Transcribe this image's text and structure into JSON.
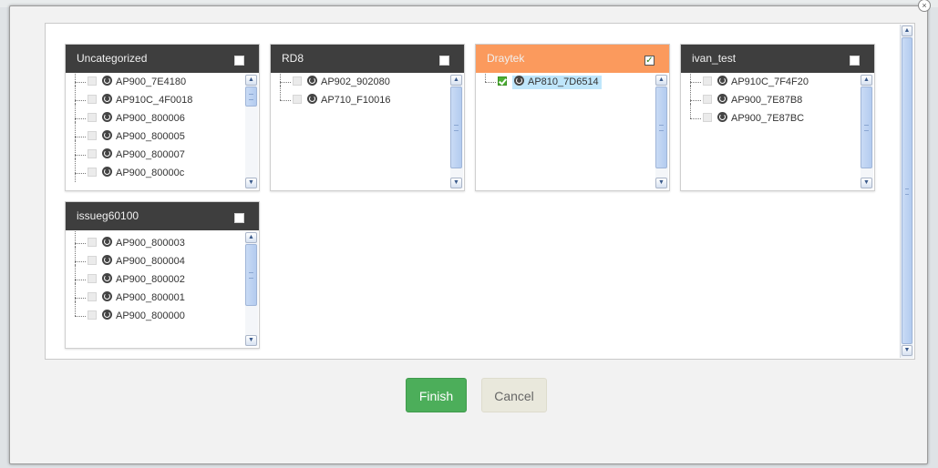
{
  "dialog": {
    "close_glyph": "×"
  },
  "groups": [
    {
      "title": "Uncategorized",
      "header_color": "#3e3e3e",
      "checked": false,
      "items": [
        {
          "label": "AP900_7E4180",
          "checked": false
        },
        {
          "label": "AP910C_4F0018",
          "checked": false
        },
        {
          "label": "AP900_800006",
          "checked": false
        },
        {
          "label": "AP900_800005",
          "checked": false
        },
        {
          "label": "AP900_800007",
          "checked": false
        },
        {
          "label": "AP900_80000c",
          "checked": false
        }
      ]
    },
    {
      "title": "RD8",
      "header_color": "#3e3e3e",
      "checked": false,
      "items": [
        {
          "label": "AP902_902080",
          "checked": false
        },
        {
          "label": "AP710_F10016",
          "checked": false
        }
      ]
    },
    {
      "title": "Draytek",
      "header_color": "#fb9a5d",
      "checked": true,
      "items": [
        {
          "label": "AP810_7D6514",
          "checked": true,
          "selected": true
        }
      ]
    },
    {
      "title": "ivan_test",
      "header_color": "#3e3e3e",
      "checked": false,
      "items": [
        {
          "label": "AP910C_7F4F20",
          "checked": false
        },
        {
          "label": "AP900_7E87B8",
          "checked": false
        },
        {
          "label": "AP900_7E87BC",
          "checked": false
        }
      ]
    },
    {
      "title": "issueg60100",
      "header_color": "#3e3e3e",
      "checked": false,
      "items": [
        {
          "label": "AP900_800003",
          "checked": false
        },
        {
          "label": "AP900_800004",
          "checked": false
        },
        {
          "label": "AP900_800002",
          "checked": false
        },
        {
          "label": "AP900_800001",
          "checked": false
        },
        {
          "label": "AP900_800000",
          "checked": false
        }
      ]
    }
  ],
  "icons": {
    "group_checkbox": "checkbox-icon",
    "device": "access-point-icon",
    "scroll_up": "chevron-up-icon",
    "scroll_down": "chevron-down-icon"
  },
  "buttons": {
    "finish": "Finish",
    "cancel": "Cancel"
  },
  "colors": {
    "finish": "#4cae5a",
    "cancel": "#e9e8dc",
    "selected_group": "#fb9a5d"
  }
}
